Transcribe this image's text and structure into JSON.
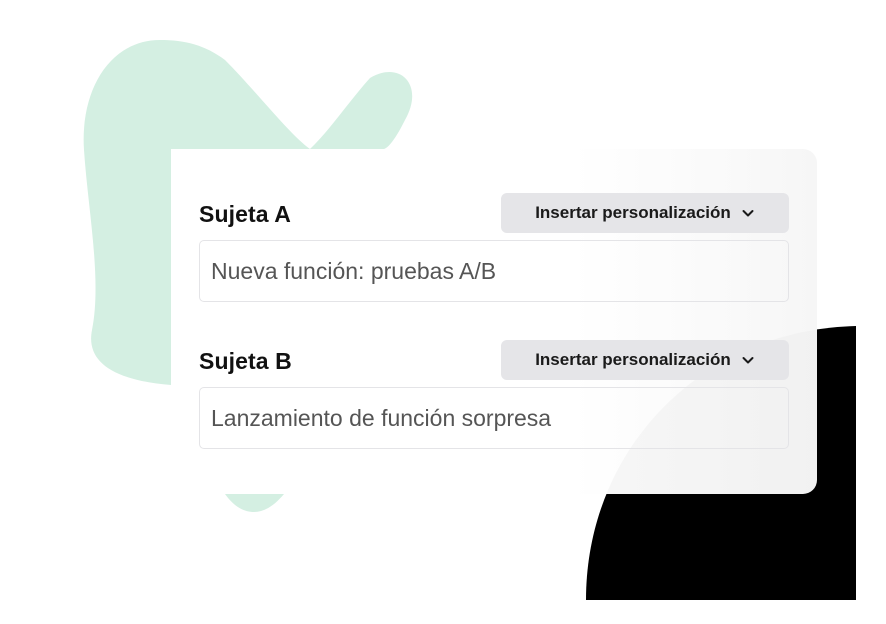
{
  "colors": {
    "accent_mint": "#d4efe2",
    "dark_shape": "#000000",
    "dropdown_bg": "#e5e5e8",
    "input_border": "#e4e4e7"
  },
  "fields": [
    {
      "label": "Sujeta A",
      "dropdown_label": "Insertar personalización",
      "dropdown_icon": "chevron-down-icon",
      "value": "Nueva función: pruebas A/B"
    },
    {
      "label": "Sujeta B",
      "dropdown_label": "Insertar personalización",
      "dropdown_icon": "chevron-down-icon",
      "value": "Lanzamiento de función sorpresa"
    }
  ]
}
